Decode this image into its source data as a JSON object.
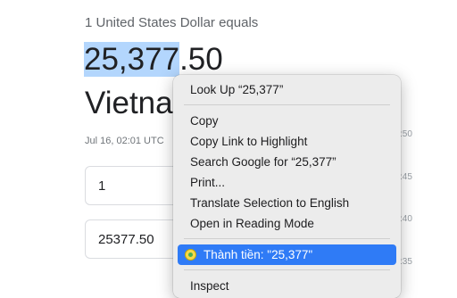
{
  "converter": {
    "equals_text": "1 United States Dollar equals",
    "amount_selected": "25,377",
    "amount_rest": ".50",
    "currency_name": "Vietna",
    "timestamp": "Jul 16, 02:01 UTC",
    "input_value": "1",
    "output_value": "25377.50"
  },
  "chart_ticks": [
    ":50",
    ":45",
    ":40",
    ":35"
  ],
  "context_menu": {
    "look_up": "Look Up “25,377”",
    "copy": "Copy",
    "copy_link_highlight": "Copy Link to Highlight",
    "search_google": "Search Google for “25,377”",
    "print": "Print...",
    "translate": "Translate Selection to English",
    "reading_mode": "Open in Reading Mode",
    "extension_item": "Thành tiền: \"25,377\"",
    "extension_icon": "coin-icon",
    "inspect": "Inspect"
  },
  "colors": {
    "selection": "#b3d6fd",
    "menu_highlight": "#2f7bf6",
    "menu_background": "#ececec"
  }
}
